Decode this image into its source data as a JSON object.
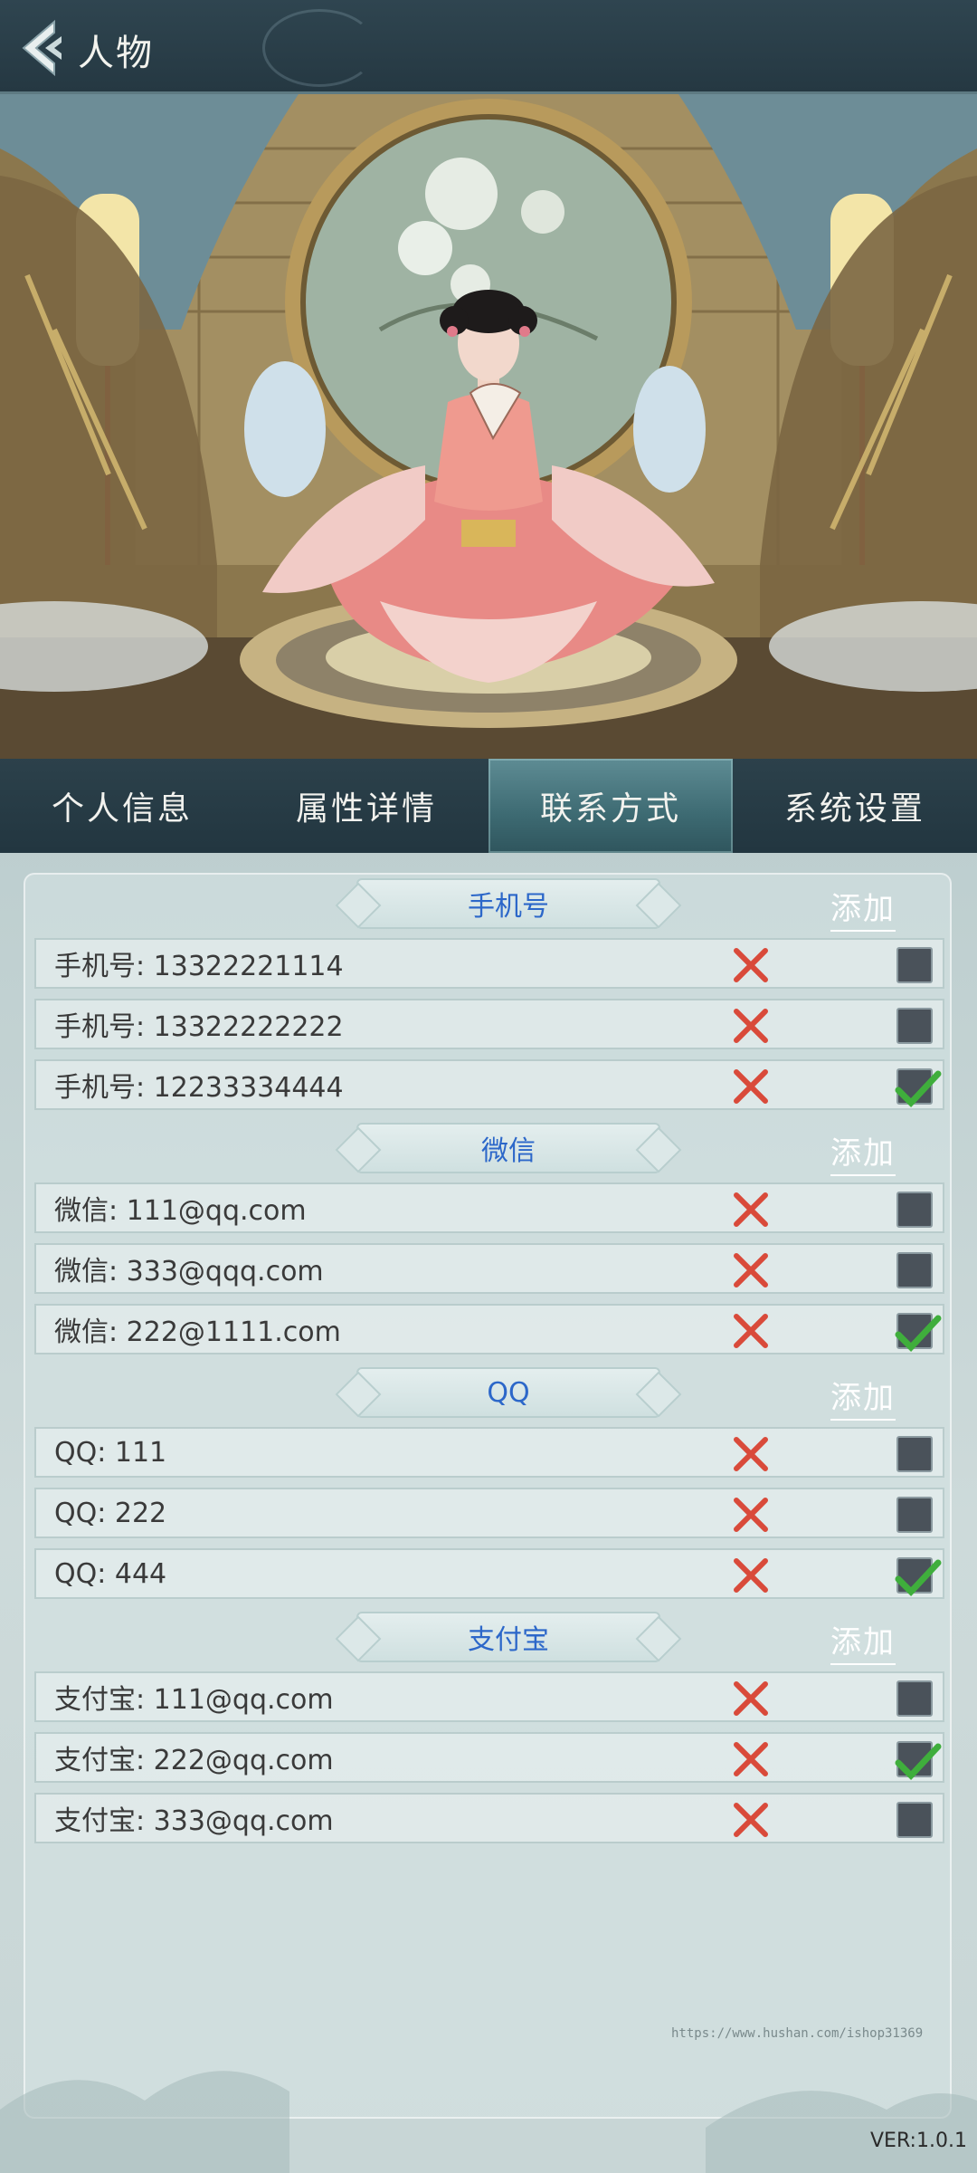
{
  "header": {
    "title": "人物"
  },
  "tabs": [
    {
      "label": "个人信息",
      "active": false
    },
    {
      "label": "属性详情",
      "active": false
    },
    {
      "label": "联系方式",
      "active": true
    },
    {
      "label": "系统设置",
      "active": false
    }
  ],
  "sections": [
    {
      "title": "手机号",
      "add_label": "添加",
      "rows": [
        {
          "text": "手机号: 13322221114",
          "checked": false
        },
        {
          "text": "手机号: 13322222222",
          "checked": false
        },
        {
          "text": "手机号: 12233334444",
          "checked": true
        }
      ]
    },
    {
      "title": "微信",
      "add_label": "添加",
      "rows": [
        {
          "text": "微信: 111@qq.com",
          "checked": false
        },
        {
          "text": "微信: 333@qqq.com",
          "checked": false
        },
        {
          "text": "微信: 222@1111.com",
          "checked": true
        }
      ]
    },
    {
      "title": "QQ",
      "add_label": "添加",
      "rows": [
        {
          "text": "QQ: 111",
          "checked": false
        },
        {
          "text": "QQ: 222",
          "checked": false
        },
        {
          "text": "QQ: 444",
          "checked": true
        }
      ]
    },
    {
      "title": "支付宝",
      "add_label": "添加",
      "rows": [
        {
          "text": "支付宝: 111@qq.com",
          "checked": false
        },
        {
          "text": "支付宝: 222@qq.com",
          "checked": true
        },
        {
          "text": "支付宝: 333@qq.com",
          "checked": false
        }
      ]
    }
  ],
  "watermark": "https://www.hushan.com/ishop31369",
  "version": "VER:1.0.1",
  "icons": {
    "back": "back-arrow-icon",
    "delete": "red-x-icon",
    "check": "green-check-icon"
  },
  "colors": {
    "accent_blue": "#2c67c9",
    "delete_red": "#d94a3a",
    "check_green": "#3fae3c",
    "tab_active": "#3d6a72"
  }
}
